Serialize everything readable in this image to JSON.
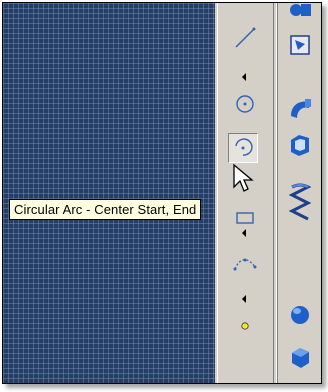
{
  "tooltip": {
    "text": "Circular Arc - Center  Start, End"
  },
  "sketch_toolbar": {
    "tools": [
      {
        "icon": "line-icon"
      },
      {
        "icon": "circle-icon"
      },
      {
        "icon": "circular-arc-center-icon",
        "pressed": true
      },
      {
        "icon": "rectangle-icon"
      },
      {
        "icon": "spline-icon"
      },
      {
        "icon": "point-icon"
      }
    ]
  },
  "feature_toolbar": {
    "tools": [
      {
        "icon": "extrude-icon"
      },
      {
        "icon": "revolve-icon"
      },
      {
        "icon": "sweep-icon"
      },
      {
        "icon": "shell-icon"
      },
      {
        "icon": "helix-icon"
      },
      {
        "icon": "sphere-icon"
      },
      {
        "icon": "box-icon"
      }
    ]
  },
  "colors": {
    "canvas": "#243e66",
    "toolbar": "#d4d0c8",
    "tooltip_bg": "#ffffe1",
    "icon_blue": "#1f5fc8",
    "sketch_blue": "#3463b0",
    "point_yellow": "#f5e81c"
  }
}
